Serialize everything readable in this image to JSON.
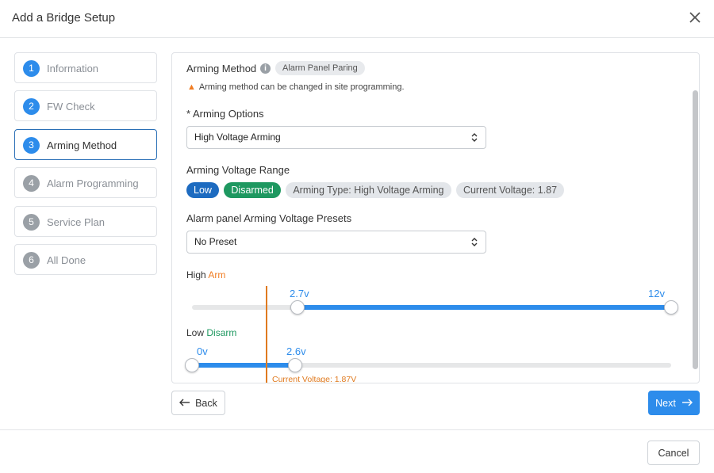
{
  "window": {
    "title": "Add a Bridge Setup",
    "close_icon": "close-icon"
  },
  "steps": [
    {
      "number": "1",
      "label": "Information",
      "state": "done"
    },
    {
      "number": "2",
      "label": "FW Check",
      "state": "done"
    },
    {
      "number": "3",
      "label": "Arming Method",
      "state": "active"
    },
    {
      "number": "4",
      "label": "Alarm Programming",
      "state": "pending"
    },
    {
      "number": "5",
      "label": "Service Plan",
      "state": "pending"
    },
    {
      "number": "6",
      "label": "All Done",
      "state": "pending"
    }
  ],
  "arming_method": {
    "title": "Arming Method",
    "info_icon": "info-icon",
    "badge": "Alarm Panel Paring",
    "warning_icon": "warning-icon",
    "warning_text": "Arming method can be changed in site programming."
  },
  "arming_options": {
    "label": "* Arming Options",
    "selected": "High Voltage Arming"
  },
  "voltage_range": {
    "label": "Arming Voltage Range",
    "chips": {
      "low": "Low",
      "disarmed": "Disarmed",
      "arming_type": "Arming Type: High Voltage Arming",
      "current_voltage": "Current Voltage: 1.87"
    }
  },
  "presets": {
    "label": "Alarm panel Arming Voltage Presets",
    "selected": "No Preset"
  },
  "high_slider": {
    "label_prefix": "High",
    "label_accent": "Arm",
    "min_label": "2.7v",
    "max_label": "12v",
    "min_value": 2.7,
    "max_value": 12,
    "fill_range_pct": [
      22,
      100
    ]
  },
  "low_slider": {
    "label_prefix": "Low",
    "label_accent": "Disarm",
    "min_label": "0v",
    "max_label": "2.6v",
    "min_value": 0,
    "max_value": 2.6,
    "fill_range_pct": [
      0,
      21.5
    ]
  },
  "current_marker": {
    "label": "Current Voltage: 1.87V",
    "value": 1.87
  },
  "nav": {
    "back_label": "Back",
    "next_label": "Next"
  },
  "footer": {
    "cancel_label": "Cancel"
  },
  "colors": {
    "primary": "#2d8ceb",
    "low_chip": "#1d6bc0",
    "disarmed_chip": "#1e9860",
    "arm_accent": "#f07c22",
    "current_marker": "#e07a1f"
  }
}
